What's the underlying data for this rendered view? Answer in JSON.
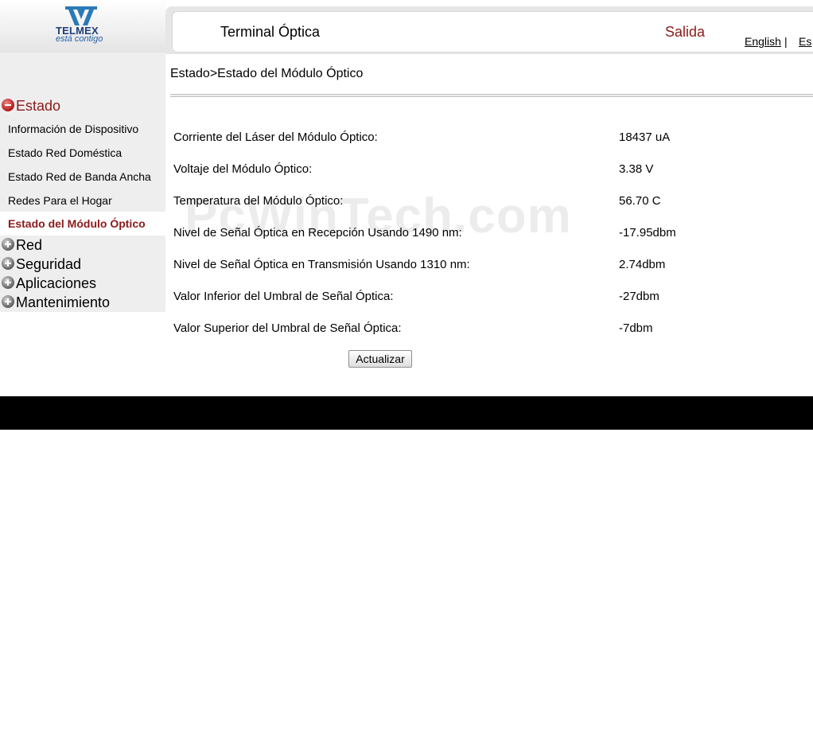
{
  "brand": {
    "name": "TELMEX",
    "tagline": "está contigo",
    "logo_icon": "telmex-logo-icon",
    "color": "#1f3f7a"
  },
  "header": {
    "title": "Terminal Óptica",
    "logout_label": "Salida",
    "lang_english": "English",
    "lang_separator": "|",
    "lang_spanish": "Es"
  },
  "sidebar": {
    "groups": [
      {
        "label": "Estado",
        "state": "expanded",
        "icon": "collapse-minus-icon",
        "items": [
          {
            "label": "Información de Dispositivo"
          },
          {
            "label": "Estado Red Doméstica"
          },
          {
            "label": "Estado Red de Banda Ancha"
          },
          {
            "label": "Redes Para el Hogar"
          },
          {
            "label": "Estado del Módulo Óptico",
            "selected": true
          }
        ]
      },
      {
        "label": "Red",
        "state": "collapsed",
        "icon": "expand-plus-icon"
      },
      {
        "label": "Seguridad",
        "state": "collapsed",
        "icon": "expand-plus-icon"
      },
      {
        "label": "Aplicaciones",
        "state": "collapsed",
        "icon": "expand-plus-icon"
      },
      {
        "label": "Mantenimiento",
        "state": "collapsed",
        "icon": "expand-plus-icon"
      }
    ]
  },
  "main": {
    "breadcrumb": "Estado>Estado del Módulo Óptico",
    "rows": [
      {
        "label": "Corriente del Láser del Módulo Óptico:",
        "value": "18437 uA"
      },
      {
        "label": "Voltaje del Módulo Óptico:",
        "value": "3.38 V"
      },
      {
        "label": "Temperatura del Módulo Óptico:",
        "value": "56.70 C"
      },
      {
        "label": "Nivel de Señal Óptica en Recepción Usando 1490 nm:",
        "value": "-17.95dbm"
      },
      {
        "label": "Nivel de Señal Óptica en Transmisión Usando 1310 nm:",
        "value": "2.74dbm"
      },
      {
        "label": "Valor Inferior del Umbral de Señal Óptica:",
        "value": "-27dbm"
      },
      {
        "label": "Valor Superior del Umbral de Señal Óptica:",
        "value": "-7dbm"
      }
    ],
    "refresh_label": "Actualizar"
  },
  "watermark": "PcWinTech.com",
  "colors": {
    "accent": "#8b1a1a",
    "sidebar_bg": "#eeeeee",
    "footer": "#000000"
  }
}
